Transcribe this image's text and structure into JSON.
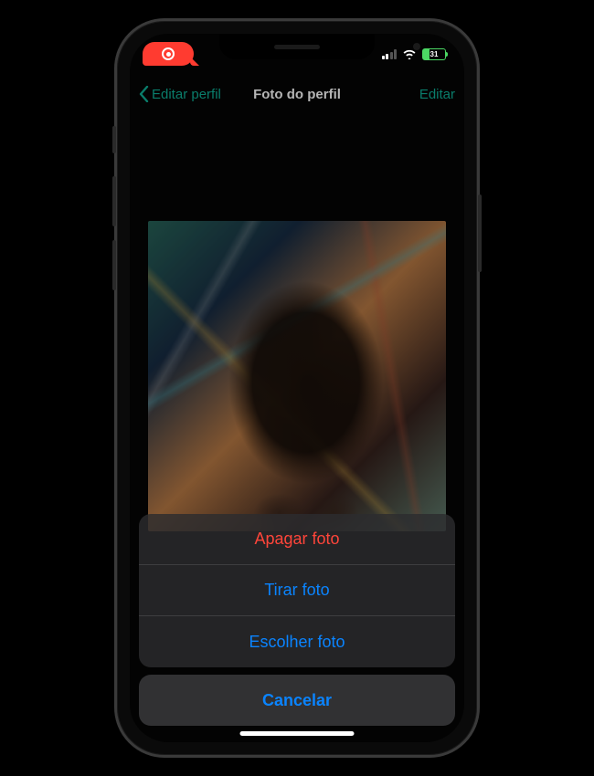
{
  "status": {
    "battery_text": "31",
    "recording": true
  },
  "nav": {
    "back_label": "Editar perfil",
    "title": "Foto do perfil",
    "action_label": "Editar"
  },
  "action_sheet": {
    "items": [
      {
        "label": "Apagar foto",
        "style": "destructive"
      },
      {
        "label": "Tirar foto",
        "style": "default"
      },
      {
        "label": "Escolher foto",
        "style": "default"
      }
    ],
    "cancel_label": "Cancelar"
  }
}
